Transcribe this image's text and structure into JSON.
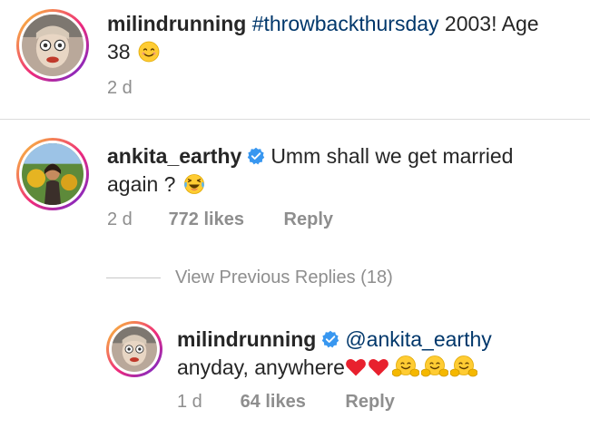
{
  "post": {
    "username": "milindrunning",
    "hashtag": "#throwbackthursday",
    "caption_tail": " 2003! Age",
    "caption_line2": "38",
    "emoji": "smiling-face-icon",
    "time": "2 d"
  },
  "comment": {
    "username": "ankita_earthy",
    "verified": true,
    "text_line1": "Umm shall we get married",
    "text_line2": "again ?",
    "emoji": "laughing-tears-icon",
    "time": "2 d",
    "likes": "772 likes",
    "reply_label": "Reply"
  },
  "view_replies": {
    "label": "View Previous Replies (18)"
  },
  "reply": {
    "username": "milindrunning",
    "verified": true,
    "mention": "@ankita_earthy",
    "text": "anyday, anywhere",
    "emojis": [
      "heart-icon",
      "heart-icon",
      "hugging-face-icon",
      "hugging-face-icon",
      "hugging-face-icon"
    ],
    "time": "1 d",
    "likes": "64 likes",
    "reply_label": "Reply"
  },
  "colors": {
    "text": "#262626",
    "secondary": "#8e8e8e",
    "link": "#00376b",
    "verified_blue": "#3897f0",
    "heart_red": "#ed4956",
    "emoji_yellow": "#ffcc33"
  }
}
